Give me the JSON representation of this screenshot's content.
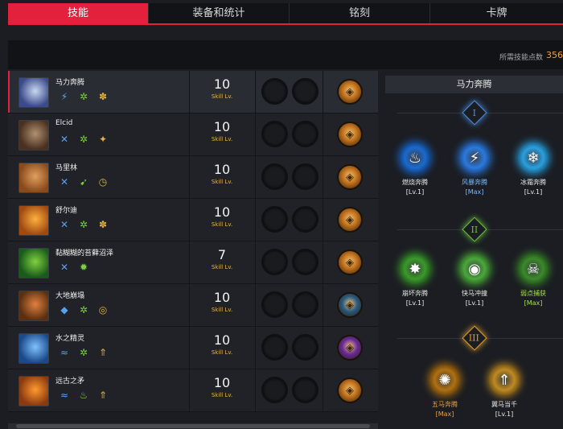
{
  "tabs": [
    {
      "label": "技能",
      "active": true
    },
    {
      "label": "装备和统计",
      "active": false
    },
    {
      "label": "铭刻",
      "active": false
    },
    {
      "label": "卡牌",
      "active": false
    }
  ],
  "points": {
    "label": "所需技能点数",
    "value": "356"
  },
  "skills": [
    {
      "name": "马力奔腾",
      "level": "10",
      "unit": "Skill Lv.",
      "selected": true,
      "portrait_colors": [
        "#3a4a8a",
        "#c8d8f0"
      ],
      "core_color": "#c0701c",
      "sub_icons": [
        "lightning-icon",
        "swirl-icon",
        "paw-icon"
      ]
    },
    {
      "name": "Elcid",
      "level": "10",
      "unit": "Skill Lv.",
      "selected": false,
      "portrait_colors": [
        "#4a3020",
        "#b09070"
      ],
      "core_color": "#c0701c",
      "sub_icons": [
        "cross-icon",
        "swirl-icon",
        "wings-icon"
      ]
    },
    {
      "name": "马里林",
      "level": "10",
      "unit": "Skill Lv.",
      "selected": false,
      "portrait_colors": [
        "#8a4a1a",
        "#e0a060"
      ],
      "core_color": "#c0701c",
      "sub_icons": [
        "cross-icon",
        "dash-icon",
        "timer-icon"
      ]
    },
    {
      "name": "舒尔迪",
      "level": "10",
      "unit": "Skill Lv.",
      "selected": false,
      "portrait_colors": [
        "#a04a10",
        "#ffb040"
      ],
      "core_color": "#c0701c",
      "sub_icons": [
        "cross-icon",
        "swirl-icon",
        "paw-icon"
      ]
    },
    {
      "name": "黏糊糊的苔藓沼泽",
      "level": "7",
      "unit": "Skill Lv.",
      "selected": false,
      "portrait_colors": [
        "#1a5a1a",
        "#80d040"
      ],
      "core_color": "#c0701c",
      "sub_icons": [
        "cross-icon",
        "gear-icon"
      ]
    },
    {
      "name": "大地崩塌",
      "level": "10",
      "unit": "Skill Lv.",
      "selected": false,
      "portrait_colors": [
        "#5a3010",
        "#e08040"
      ],
      "core_color": "#2a5a80",
      "sub_icons": [
        "drop-icon",
        "swirl-icon",
        "target-icon"
      ]
    },
    {
      "name": "水之精灵",
      "level": "10",
      "unit": "Skill Lv.",
      "selected": false,
      "portrait_colors": [
        "#1a4a8a",
        "#80c0ff"
      ],
      "core_color": "#6a2a9a",
      "sub_icons": [
        "wave-icon",
        "swirl-icon",
        "arrow-up-icon"
      ]
    },
    {
      "name": "远古之矛",
      "level": "10",
      "unit": "Skill Lv.",
      "selected": false,
      "portrait_colors": [
        "#8a3a10",
        "#ff9a30"
      ],
      "core_color": "#c0701c",
      "sub_icons": [
        "wave-icon",
        "flame-icon",
        "arrow-up-icon"
      ]
    }
  ],
  "tree": {
    "title": "马力奔腾",
    "tiers": [
      {
        "numeral": "I",
        "color": "#4a90e0",
        "nodes": [
          {
            "name": "燃烧奔腾",
            "level": "[Lv.1]",
            "name_color": "#e6e6e6",
            "level_color": "#e6e6e6",
            "icon_color": "#1a6ad0",
            "glyph": "♨",
            "icon": "flame-icon"
          },
          {
            "name": "风暴奔腾",
            "level": "[Max]",
            "name_color": "#7ab8ff",
            "level_color": "#7ab8ff",
            "icon_color": "#2a7ae0",
            "glyph": "⚡",
            "icon": "lightning-icon"
          },
          {
            "name": "冰霜奔腾",
            "level": "[Lv.1]",
            "name_color": "#e6e6e6",
            "level_color": "#e6e6e6",
            "icon_color": "#2aa0e0",
            "glyph": "❄",
            "icon": "snowflake-icon"
          }
        ]
      },
      {
        "numeral": "II",
        "color": "#6ac040",
        "nodes": [
          {
            "name": "崩坏奔腾",
            "level": "[Lv.1]",
            "name_color": "#e6e6e6",
            "level_color": "#e6e6e6",
            "icon_color": "#3a9a2a",
            "glyph": "✸",
            "icon": "burst-icon"
          },
          {
            "name": "快马冲撞",
            "level": "[Lv.1]",
            "name_color": "#e6e6e6",
            "level_color": "#e6e6e6",
            "icon_color": "#4aa83a",
            "glyph": "◉",
            "icon": "charge-icon"
          },
          {
            "name": "弱点捕获",
            "level": "[Max]",
            "name_color": "#a8e040",
            "level_color": "#a8e040",
            "icon_color": "#3a8a2a",
            "glyph": "☠",
            "icon": "skull-icon"
          }
        ]
      },
      {
        "numeral": "III",
        "color": "#e0a030",
        "nodes": [
          {
            "name": "五马奔腾",
            "level": "[Max]",
            "name_color": "#f0a030",
            "level_color": "#f0a030",
            "icon_color": "#b07010",
            "glyph": "✺",
            "icon": "spiral-icon"
          },
          {
            "name": "翼马当千",
            "level": "[Lv.1]",
            "name_color": "#e6e6e6",
            "level_color": "#e6e6e6",
            "icon_color": "#c08a20",
            "glyph": "⇑",
            "icon": "arrow-up-icon"
          }
        ]
      }
    ]
  }
}
